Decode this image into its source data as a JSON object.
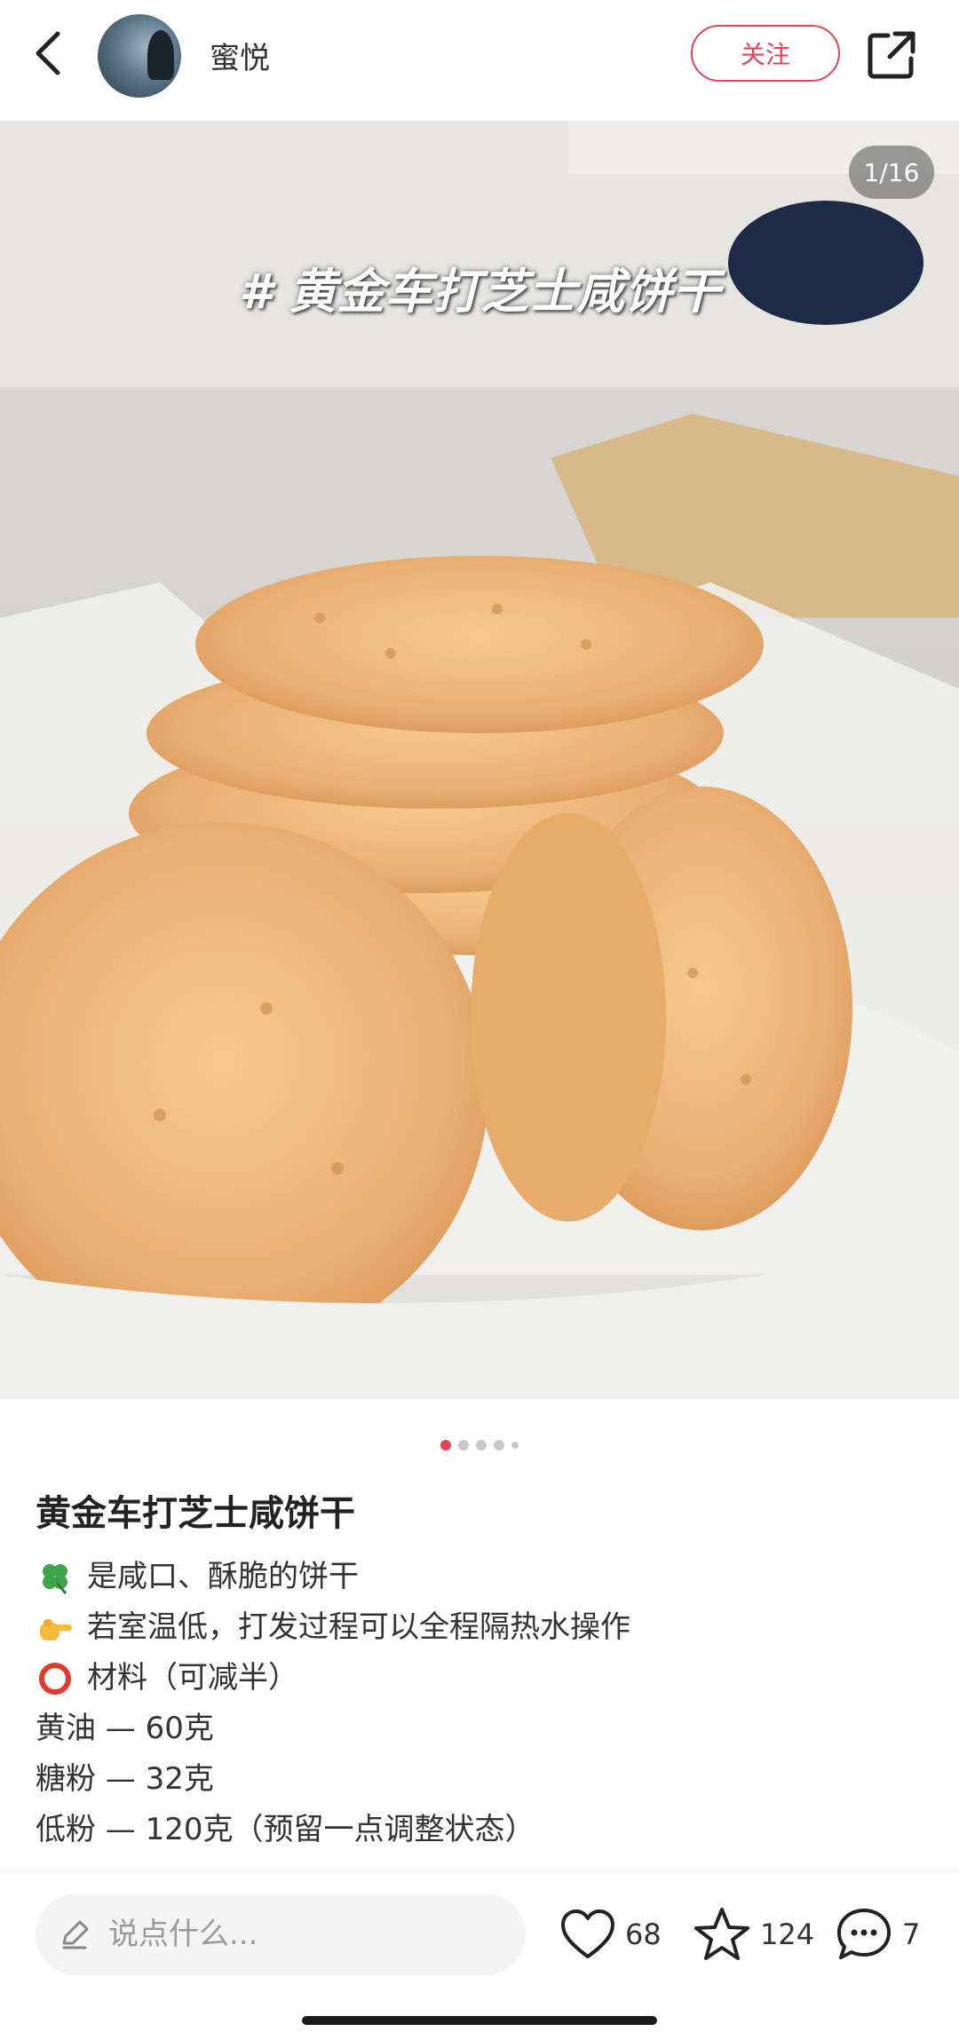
{
  "header": {
    "username": "蜜悦",
    "follow_label": "关注"
  },
  "photo": {
    "counter": "1/16",
    "overlay_title": "# 黄金车打芝士咸饼干"
  },
  "pagination": {
    "total_visible": 5,
    "active_index": 0
  },
  "post": {
    "title": "黄金车打芝士咸饼干",
    "lines": [
      {
        "icon": "clover-icon",
        "text": "是咸口、酥脆的饼干"
      },
      {
        "icon": "pointing-hand-icon",
        "text": "若室温低，打发过程可以全程隔热水操作"
      },
      {
        "icon": "red-circle-icon",
        "text": "材料（可减半）"
      },
      {
        "icon": "",
        "text": "黄油 — 60克"
      },
      {
        "icon": "",
        "text": "糖粉 — 32克"
      },
      {
        "icon": "",
        "text": "低粉 — 120克（预留一点调整状态）"
      }
    ]
  },
  "bottom_bar": {
    "comment_placeholder": "说点什么...",
    "likes": "68",
    "favorites": "124",
    "comments": "7"
  },
  "colors": {
    "accent": "#e0455a",
    "background": "#ffffff"
  }
}
